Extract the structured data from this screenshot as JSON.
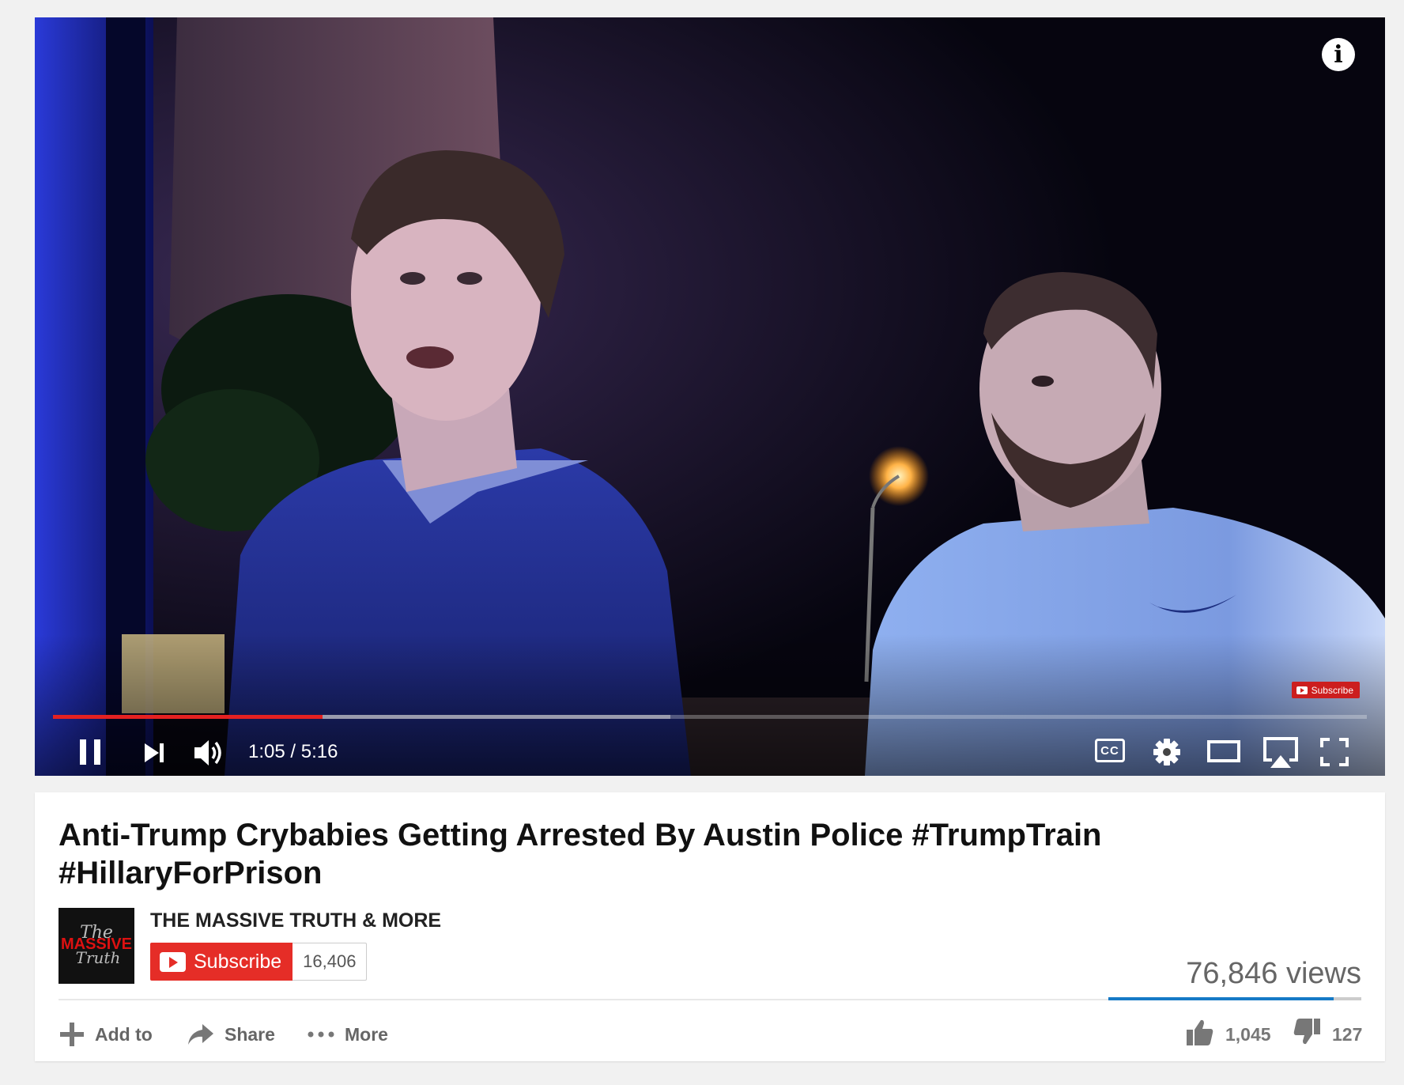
{
  "player": {
    "info_icon": "info-icon",
    "subscribe_badge": "Subscribe",
    "progress_played_fraction": 0.205,
    "progress_buffered_fraction": 0.47,
    "time_display": "1:05 / 5:16",
    "controls": [
      "pause-icon",
      "next-icon",
      "volume-icon",
      "cc-icon",
      "gear-icon",
      "theater-icon",
      "airplay-icon",
      "fullscreen-icon"
    ],
    "cc_label": "CC"
  },
  "video": {
    "title": "Anti-Trump Crybabies Getting Arrested By Austin Police #TrumpTrain #HillaryForPrison",
    "channel_name": "THE MASSIVE TRUTH & MORE",
    "subscribe_label": "Subscribe",
    "subscriber_count": "16,406",
    "views": "76,846 views",
    "like_fraction": 0.89
  },
  "actions": {
    "add_to": "Add to",
    "share": "Share",
    "more": "More"
  },
  "ratings": {
    "likes": "1,045",
    "dislikes": "127"
  },
  "colors": {
    "accent_red": "#e52d27",
    "progress_red": "#e42121",
    "like_bar_blue": "#167ac6"
  }
}
